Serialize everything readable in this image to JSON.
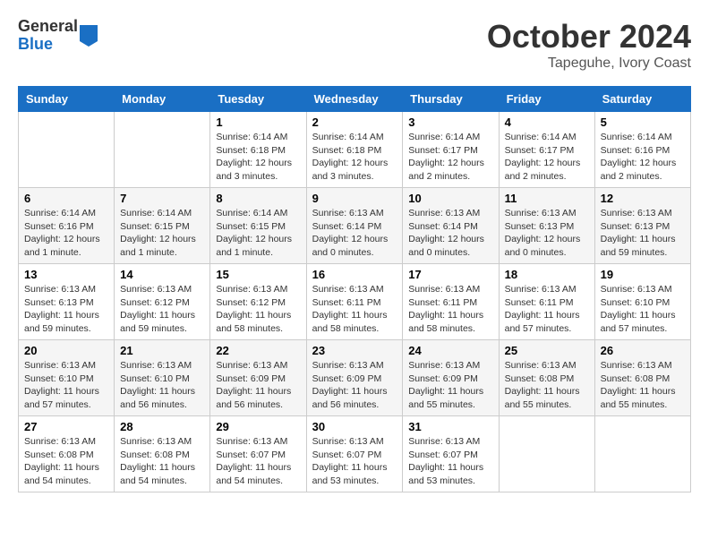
{
  "logo": {
    "general": "General",
    "blue": "Blue"
  },
  "header": {
    "month": "October 2024",
    "location": "Tapeguhe, Ivory Coast"
  },
  "weekdays": [
    "Sunday",
    "Monday",
    "Tuesday",
    "Wednesday",
    "Thursday",
    "Friday",
    "Saturday"
  ],
  "weeks": [
    [
      {
        "day": "",
        "info": ""
      },
      {
        "day": "",
        "info": ""
      },
      {
        "day": "1",
        "info": "Sunrise: 6:14 AM\nSunset: 6:18 PM\nDaylight: 12 hours and 3 minutes."
      },
      {
        "day": "2",
        "info": "Sunrise: 6:14 AM\nSunset: 6:18 PM\nDaylight: 12 hours and 3 minutes."
      },
      {
        "day": "3",
        "info": "Sunrise: 6:14 AM\nSunset: 6:17 PM\nDaylight: 12 hours and 2 minutes."
      },
      {
        "day": "4",
        "info": "Sunrise: 6:14 AM\nSunset: 6:17 PM\nDaylight: 12 hours and 2 minutes."
      },
      {
        "day": "5",
        "info": "Sunrise: 6:14 AM\nSunset: 6:16 PM\nDaylight: 12 hours and 2 minutes."
      }
    ],
    [
      {
        "day": "6",
        "info": "Sunrise: 6:14 AM\nSunset: 6:16 PM\nDaylight: 12 hours and 1 minute."
      },
      {
        "day": "7",
        "info": "Sunrise: 6:14 AM\nSunset: 6:15 PM\nDaylight: 12 hours and 1 minute."
      },
      {
        "day": "8",
        "info": "Sunrise: 6:14 AM\nSunset: 6:15 PM\nDaylight: 12 hours and 1 minute."
      },
      {
        "day": "9",
        "info": "Sunrise: 6:13 AM\nSunset: 6:14 PM\nDaylight: 12 hours and 0 minutes."
      },
      {
        "day": "10",
        "info": "Sunrise: 6:13 AM\nSunset: 6:14 PM\nDaylight: 12 hours and 0 minutes."
      },
      {
        "day": "11",
        "info": "Sunrise: 6:13 AM\nSunset: 6:13 PM\nDaylight: 12 hours and 0 minutes."
      },
      {
        "day": "12",
        "info": "Sunrise: 6:13 AM\nSunset: 6:13 PM\nDaylight: 11 hours and 59 minutes."
      }
    ],
    [
      {
        "day": "13",
        "info": "Sunrise: 6:13 AM\nSunset: 6:13 PM\nDaylight: 11 hours and 59 minutes."
      },
      {
        "day": "14",
        "info": "Sunrise: 6:13 AM\nSunset: 6:12 PM\nDaylight: 11 hours and 59 minutes."
      },
      {
        "day": "15",
        "info": "Sunrise: 6:13 AM\nSunset: 6:12 PM\nDaylight: 11 hours and 58 minutes."
      },
      {
        "day": "16",
        "info": "Sunrise: 6:13 AM\nSunset: 6:11 PM\nDaylight: 11 hours and 58 minutes."
      },
      {
        "day": "17",
        "info": "Sunrise: 6:13 AM\nSunset: 6:11 PM\nDaylight: 11 hours and 58 minutes."
      },
      {
        "day": "18",
        "info": "Sunrise: 6:13 AM\nSunset: 6:11 PM\nDaylight: 11 hours and 57 minutes."
      },
      {
        "day": "19",
        "info": "Sunrise: 6:13 AM\nSunset: 6:10 PM\nDaylight: 11 hours and 57 minutes."
      }
    ],
    [
      {
        "day": "20",
        "info": "Sunrise: 6:13 AM\nSunset: 6:10 PM\nDaylight: 11 hours and 57 minutes."
      },
      {
        "day": "21",
        "info": "Sunrise: 6:13 AM\nSunset: 6:10 PM\nDaylight: 11 hours and 56 minutes."
      },
      {
        "day": "22",
        "info": "Sunrise: 6:13 AM\nSunset: 6:09 PM\nDaylight: 11 hours and 56 minutes."
      },
      {
        "day": "23",
        "info": "Sunrise: 6:13 AM\nSunset: 6:09 PM\nDaylight: 11 hours and 56 minutes."
      },
      {
        "day": "24",
        "info": "Sunrise: 6:13 AM\nSunset: 6:09 PM\nDaylight: 11 hours and 55 minutes."
      },
      {
        "day": "25",
        "info": "Sunrise: 6:13 AM\nSunset: 6:08 PM\nDaylight: 11 hours and 55 minutes."
      },
      {
        "day": "26",
        "info": "Sunrise: 6:13 AM\nSunset: 6:08 PM\nDaylight: 11 hours and 55 minutes."
      }
    ],
    [
      {
        "day": "27",
        "info": "Sunrise: 6:13 AM\nSunset: 6:08 PM\nDaylight: 11 hours and 54 minutes."
      },
      {
        "day": "28",
        "info": "Sunrise: 6:13 AM\nSunset: 6:08 PM\nDaylight: 11 hours and 54 minutes."
      },
      {
        "day": "29",
        "info": "Sunrise: 6:13 AM\nSunset: 6:07 PM\nDaylight: 11 hours and 54 minutes."
      },
      {
        "day": "30",
        "info": "Sunrise: 6:13 AM\nSunset: 6:07 PM\nDaylight: 11 hours and 53 minutes."
      },
      {
        "day": "31",
        "info": "Sunrise: 6:13 AM\nSunset: 6:07 PM\nDaylight: 11 hours and 53 minutes."
      },
      {
        "day": "",
        "info": ""
      },
      {
        "day": "",
        "info": ""
      }
    ]
  ]
}
